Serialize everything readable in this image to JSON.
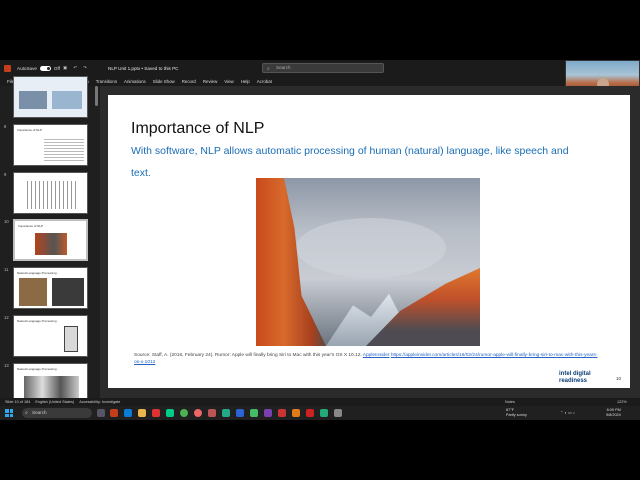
{
  "titlebar": {
    "autosave": "AutoSave",
    "autosave_state": "Off",
    "document": "NLP Unit 1.pptx • Saved to this PC",
    "search_placeholder": "Search"
  },
  "ribbon_tabs": [
    "File",
    "Home",
    "Insert",
    "Draw",
    "Design",
    "Transitions",
    "Animations",
    "Slide Show",
    "Record",
    "Review",
    "View",
    "Help",
    "Acrobat"
  ],
  "webcam": {
    "name": "Tobi Kyrr"
  },
  "thumbnails": {
    "numbers": [
      "8",
      "9",
      "10",
      "11",
      "12",
      "13"
    ],
    "titles": [
      "Importance of NLP",
      "",
      "Importance of NLP",
      "Natural Language Processing",
      "Natural Language Processing",
      "Natural Language Processing"
    ]
  },
  "slide": {
    "title": "Importance of NLP",
    "body": "With software, NLP allows automatic processing of human (natural) language, like speech and text.",
    "source_prefix": "Source:  Staff, A. (2016, February 24). Rumor: Apple will finally bring Siri to Mac with this year's OS X 10.12.",
    "source_site": "AppleInsider",
    "source_url": "https://appleinsider.com/articles/16/02/24/rumor-apple-will-finally-bring-siri-to-mac-with-this-years-os-x-1012",
    "brand_line1": "intel digital",
    "brand_line2": "readiness",
    "number": "10"
  },
  "statusbar": {
    "slide_count": "Slide 10 of 184",
    "language": "English (United States)",
    "accessibility": "Accessibility: Investigate",
    "notes": "Notes",
    "zoom": "122%"
  },
  "taskbar": {
    "search": "Search",
    "weather_temp": "87°F",
    "weather_desc": "Partly sunny",
    "time": "8:09 PM",
    "date": "9/8/2024"
  },
  "colors": {
    "accent": "#1a6db5",
    "powerpoint": "#c43e1c",
    "brand": "#0a3d7a"
  }
}
